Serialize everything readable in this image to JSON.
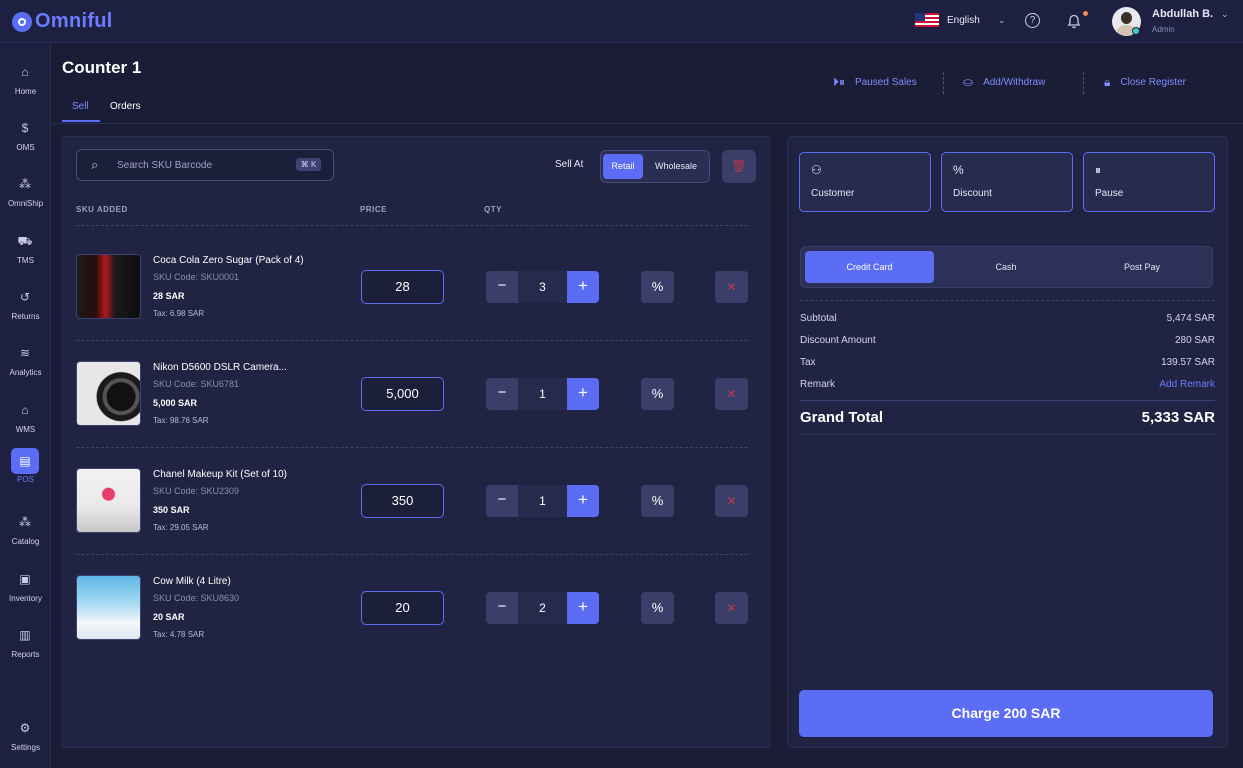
{
  "app": {
    "logo": "Omniful"
  },
  "header": {
    "language": "English",
    "user": {
      "name": "Abdullah B.",
      "role": "Admin"
    }
  },
  "sidebar": {
    "items": [
      {
        "label": "Home",
        "icon": "home-icon"
      },
      {
        "label": "OMS",
        "icon": "dollar-circle-icon"
      },
      {
        "label": "OmniShip",
        "icon": "network-icon"
      },
      {
        "label": "TMS",
        "icon": "truck-icon"
      },
      {
        "label": "Returns",
        "icon": "return-icon"
      },
      {
        "label": "Analytics",
        "icon": "chart-icon"
      },
      {
        "label": "WMS",
        "icon": "warehouse-icon"
      },
      {
        "label": "POS",
        "icon": "register-icon"
      },
      {
        "label": "Catalog",
        "icon": "shapes-icon"
      },
      {
        "label": "Inventory",
        "icon": "box-icon"
      },
      {
        "label": "Reports",
        "icon": "report-icon"
      },
      {
        "label": "Settings",
        "icon": "gear-icon"
      }
    ]
  },
  "page": {
    "title": "Counter 1",
    "tabs": [
      "Sell",
      "Orders"
    ],
    "actions": [
      "Paused Sales",
      "Add/Withdraw",
      "Close Register"
    ]
  },
  "cart": {
    "search_placeholder": "Search SKU Barcode",
    "shortcut": "⌘ K",
    "sell_at_label": "Sell At",
    "sell_modes": [
      "Retail",
      "Wholesale"
    ],
    "columns": [
      "SKU ADDED",
      "PRICE",
      "QTY"
    ],
    "items": [
      {
        "name": "Coca Cola Zero Sugar (Pack of 4)",
        "code": "SKU Code: SKU0001",
        "price": "28 SAR",
        "tax": "Tax: 6.98 SAR",
        "price_input": "28",
        "qty": "3"
      },
      {
        "name": "Nikon D5600 DSLR Camera...",
        "code": "SKU Code: SKU6781",
        "price": "5,000 SAR",
        "tax": "Tax: 98.76 SAR",
        "price_input": "5,000",
        "qty": "1"
      },
      {
        "name": "Chanel Makeup Kit (Set of 10)",
        "code": "SKU Code: SKU2309",
        "price": "350 SAR",
        "tax": "Tax: 29.05 SAR",
        "price_input": "350",
        "qty": "1"
      },
      {
        "name": "Cow Milk (4 Litre)",
        "code": "SKU Code: SKU8630",
        "price": "20 SAR",
        "tax": "Tax: 4.78 SAR",
        "price_input": "20",
        "qty": "2"
      }
    ]
  },
  "checkout": {
    "quick_actions": [
      "Customer",
      "Discount",
      "Pause"
    ],
    "payment_methods": [
      "Credit Card",
      "Cash",
      "Post Pay"
    ],
    "summary": [
      {
        "label": "Subtotal",
        "value": "5,474 SAR"
      },
      {
        "label": "Discount Amount",
        "value": "280 SAR"
      },
      {
        "label": "Tax",
        "value": "139.57 SAR"
      },
      {
        "label": "Remark",
        "value": "Add Remark"
      }
    ],
    "grand_total_label": "Grand Total",
    "grand_total_value": "5,333 SAR",
    "charge_label": "Charge 200 SAR"
  },
  "colors": {
    "accent": "#5b6cf5",
    "background": "#1a1d35",
    "panel": "#202442",
    "danger": "#c23a4c"
  }
}
